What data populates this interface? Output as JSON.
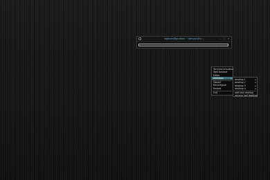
{
  "terminal": {
    "title": "wgjacko@godbox: ~/dev/src/lib/..."
  },
  "menu": {
    "items": [
      {
        "label": "Terminal emulator"
      },
      {
        "label": "Web browser"
      },
      {
        "label": "Editor"
      },
      {
        "label": "Desktops",
        "submenu": true
      },
      {
        "label": "Obconf"
      },
      {
        "label": "Reconfigure"
      },
      {
        "label": "Restart"
      },
      {
        "label": "Exit"
      }
    ]
  },
  "desktops_menu": {
    "items": [
      {
        "label": "desktop 1"
      },
      {
        "label": "desktop 2"
      },
      {
        "label": "desktop 3"
      },
      {
        "label": "desktop 4"
      },
      {
        "label": "add new desktop"
      },
      {
        "label": "remove last desktop"
      }
    ]
  },
  "colors": {
    "menu_highlight": "#3e6e78",
    "title_text": "#6fb3c8",
    "background": "#161616"
  }
}
